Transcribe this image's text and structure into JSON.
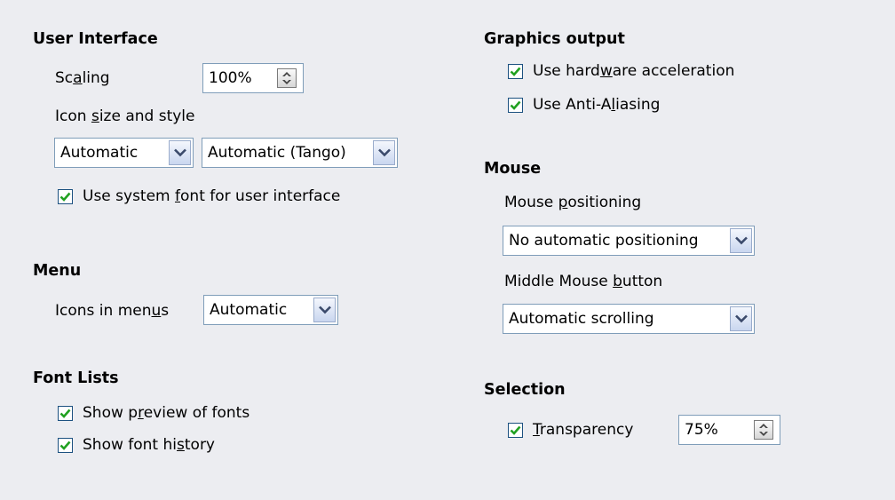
{
  "left": {
    "ui": {
      "heading": "User Interface",
      "scaling_label": [
        "Sc",
        "a",
        "ling"
      ],
      "scaling_value": "100%",
      "icon_label": [
        "Icon ",
        "s",
        "ize and style"
      ],
      "icon_size_value": "Automatic",
      "icon_style_value": "Automatic (Tango)",
      "system_font_label": [
        "Use system ",
        "f",
        "ont for user interface"
      ],
      "system_font_checked": true
    },
    "menu": {
      "heading": "Menu",
      "icons_label": [
        "Icons in men",
        "u",
        "s"
      ],
      "icons_value": "Automatic"
    },
    "font_lists": {
      "heading": "Font Lists",
      "preview_label": [
        "Show p",
        "r",
        "eview of fonts"
      ],
      "preview_checked": true,
      "history_label": [
        "Show font hi",
        "s",
        "tory"
      ],
      "history_checked": true
    }
  },
  "right": {
    "graphics": {
      "heading": "Graphics output",
      "hw_label": [
        "Use hard",
        "w",
        "are acceleration"
      ],
      "hw_checked": true,
      "aa_label": [
        "Use Anti-A",
        "l",
        "iasing"
      ],
      "aa_checked": true
    },
    "mouse": {
      "heading": "Mouse",
      "positioning_label": [
        "Mouse ",
        "p",
        "ositioning"
      ],
      "positioning_value": "No automatic positioning",
      "middle_label": [
        "Middle Mouse ",
        "b",
        "utton"
      ],
      "middle_value": "Automatic scrolling"
    },
    "selection": {
      "heading": "Selection",
      "transparency_label": [
        "",
        "T",
        "ransparency"
      ],
      "transparency_checked": true,
      "transparency_value": "75%"
    }
  },
  "icons": {
    "dropdown": "chevron-down-icon",
    "spinner": "up-down-arrows-icon",
    "check": "checkmark-icon"
  },
  "colors": {
    "background": "#ecedf1",
    "check": "#21a121",
    "field_border": "#7f9db9"
  }
}
